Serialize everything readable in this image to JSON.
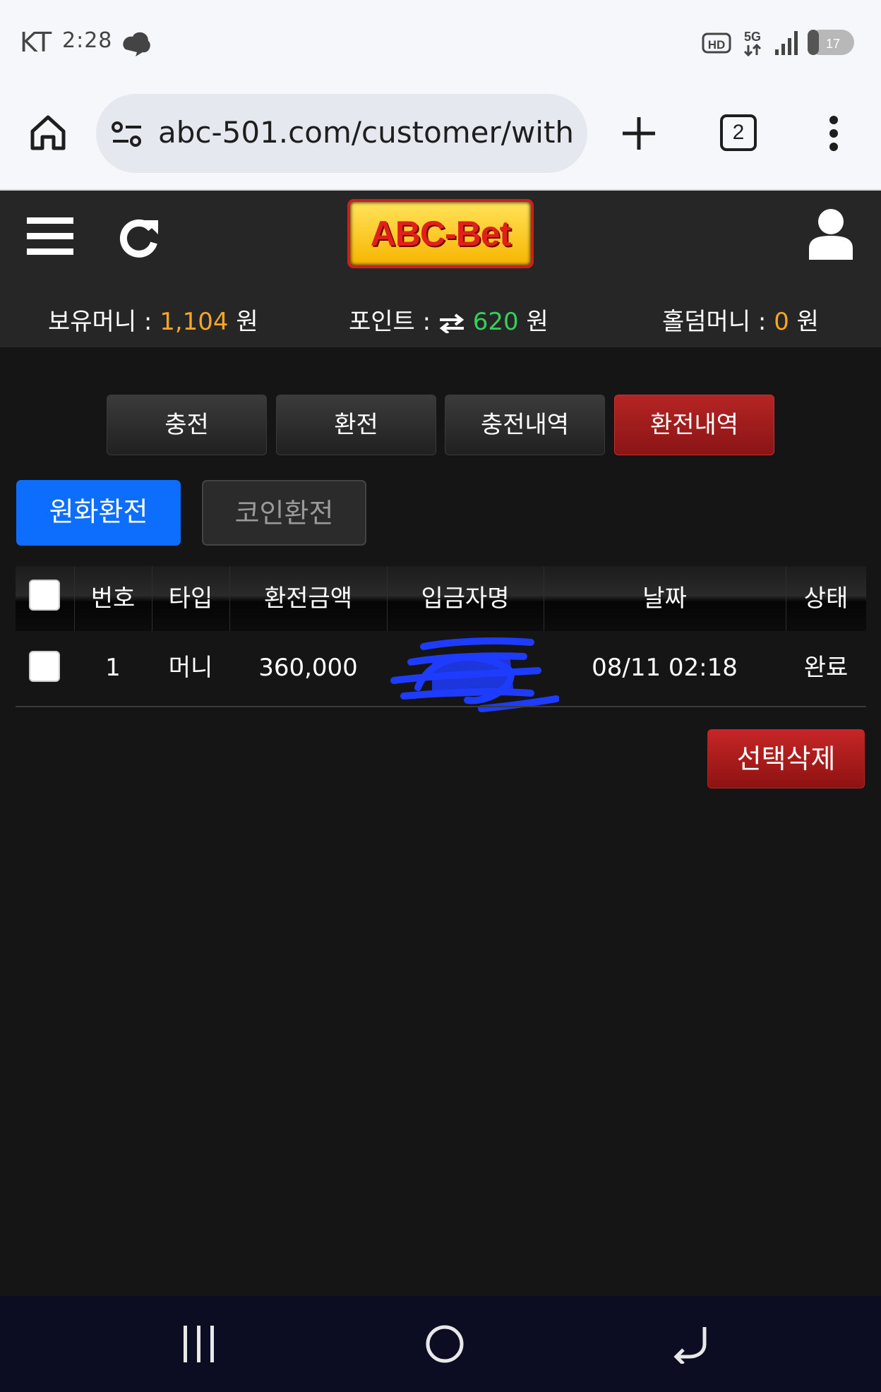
{
  "status_bar": {
    "carrier": "KT",
    "time": "2:28"
  },
  "browser": {
    "url": "abc-501.com/customer/withdra",
    "tab_count": "2"
  },
  "site": {
    "logo": "ABC-Bet",
    "balances": {
      "money_label": "보유머니 :",
      "money_value": "1,104",
      "money_unit": "원",
      "point_label": "포인트 :",
      "point_value": "620",
      "point_unit": "원",
      "holdem_label": "홀덤머니 :",
      "holdem_value": "0",
      "holdem_unit": "원"
    },
    "main_tabs": [
      "충전",
      "환전",
      "충전내역",
      "환전내역"
    ],
    "sub_tabs": [
      "원화환전",
      "코인환전"
    ],
    "table": {
      "headers": [
        "번호",
        "타입",
        "환전금액",
        "입금자명",
        "날짜",
        "상태"
      ],
      "rows": [
        {
          "no": "1",
          "type": "머니",
          "amount": "360,000",
          "name": "",
          "date": "08/11 02:18",
          "status": "완료"
        }
      ]
    },
    "delete_button": "선택삭제"
  },
  "colors": {
    "accent_red": "#a81b1b",
    "accent_blue": "#0d6efd",
    "money_orange": "#f5a623",
    "point_green": "#35d05a"
  }
}
